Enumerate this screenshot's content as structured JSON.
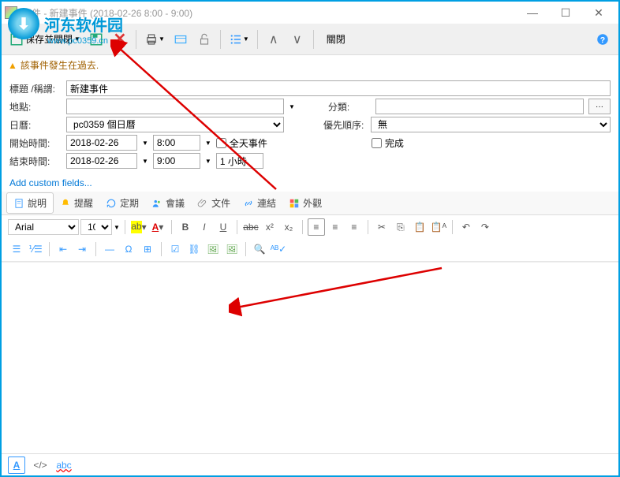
{
  "window": {
    "title": "事件 - 新建事件 (2018-02-26 8:00 - 9:00)"
  },
  "watermark": {
    "text": "河东软件园",
    "url": "www.pc0359.cn"
  },
  "toolbar": {
    "save_close": "保存並關閉",
    "close": "關閉"
  },
  "warning": "該事件發生在過去.",
  "form": {
    "title_label": "標題 /稱謂:",
    "title_value": "新建事件",
    "location_label": "地點:",
    "location_value": "",
    "category_label": "分類:",
    "category_value": "",
    "calendar_label": "日曆:",
    "calendar_value": "pc0359 個日曆",
    "priority_label": "優先順序:",
    "priority_value": "無",
    "start_label": "開始時間:",
    "start_date": "2018-02-26",
    "start_time": "8:00",
    "allday": "全天事件",
    "done": "完成",
    "end_label": "結束時間:",
    "end_date": "2018-02-26",
    "end_time": "9:00",
    "duration": "1 小時",
    "custom_fields": "Add custom fields..."
  },
  "tabs": {
    "desc": "說明",
    "remind": "提醒",
    "recur": "定期",
    "meeting": "會議",
    "file": "文件",
    "link": "連結",
    "appear": "外觀"
  },
  "editor": {
    "font": "Arial",
    "size": "10"
  },
  "footer": {
    "abc": "abc"
  }
}
